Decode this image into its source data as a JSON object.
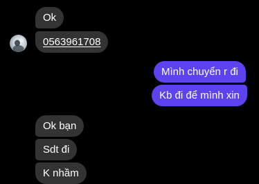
{
  "colors": {
    "background": "#000000",
    "incoming_bubble": "#333333",
    "outgoing_bubble": "#5b43f0",
    "text": "#ffffff"
  },
  "messages": [
    {
      "sender": "other",
      "text": "Ok"
    },
    {
      "sender": "other",
      "text": "0563961708",
      "is_link": true
    },
    {
      "sender": "me",
      "text": "Mình chuyển r đi"
    },
    {
      "sender": "me",
      "text": "Kb đi để mình xin"
    },
    {
      "sender": "other",
      "text": "Ok bạn"
    },
    {
      "sender": "other",
      "text": "Sdt đi"
    },
    {
      "sender": "other",
      "text": "K nhầm"
    }
  ],
  "avatar": {
    "icon": "user-avatar-photo"
  }
}
